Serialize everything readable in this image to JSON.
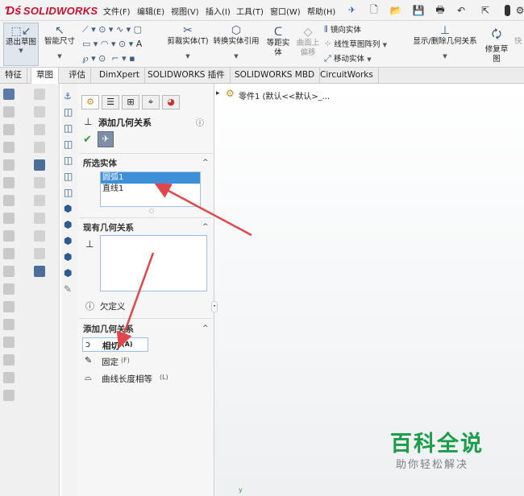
{
  "menubar": {
    "logo": "SOLIDWORKS",
    "menus": [
      "文件(F)",
      "编辑(E)",
      "视图(V)",
      "插入(I)",
      "工具(T)",
      "窗口(W)",
      "帮助(H)"
    ]
  },
  "ribbon": {
    "exit_sketch": "退出草图",
    "smart_dimension": "智能尺寸",
    "trim_entities": "剪裁实体(T)",
    "convert_entities": "转换实体引用",
    "offset_entities_1": "等距实",
    "offset_entities_2": "体",
    "offset_on_surface_1": "曲面上",
    "offset_on_surface_2": "偏移",
    "mirror_entities": "镜向实体",
    "linear_pattern": "线性草图阵列",
    "move_entities": "移动实体",
    "display_relations": "显示/删除几何关系",
    "repair_sketch_1": "修复草",
    "repair_sketch_2": "图",
    "quick": "快"
  },
  "tabs": [
    "特征",
    "草图",
    "评估",
    "DimXpert",
    "SOLIDWORKS 插件",
    "SOLIDWORKS MBD",
    "CircuitWorks"
  ],
  "active_tab": "草图",
  "pm": {
    "title": "添加几何关系",
    "selected_section": "所选实体",
    "selected_items": [
      "圆弧1",
      "直线1"
    ],
    "existing_section": "现有几何关系",
    "status": "欠定义",
    "add_section": "添加几何关系",
    "relations": [
      {
        "label": "相切",
        "key": "(A)"
      },
      {
        "label": "固定",
        "key": "(F)"
      },
      {
        "label": "曲线长度相等",
        "key": "(L)"
      }
    ]
  },
  "tree": {
    "item": "零件1 (默认<<默认>_..."
  },
  "watermark": {
    "line1": "百科全说",
    "line2": "助你轻松解决"
  },
  "colors": {
    "accent": "#3d8fd8",
    "arrow": "#e0474c",
    "brand": "#c8102e",
    "watermark": "#1a9e4a"
  }
}
